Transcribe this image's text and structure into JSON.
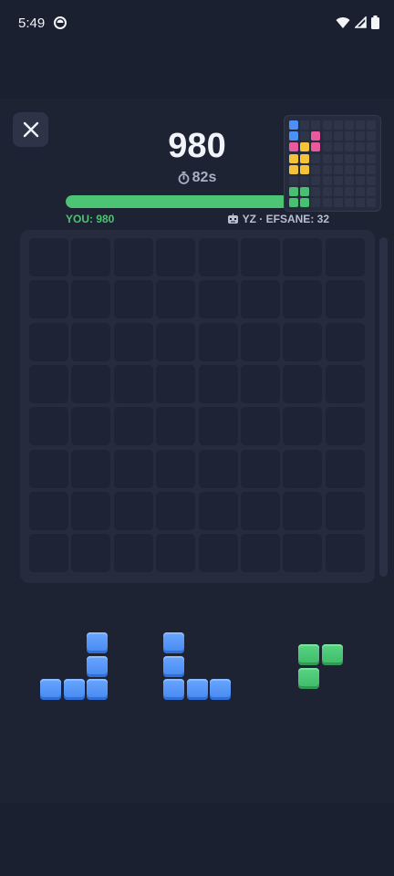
{
  "status": {
    "time": "5:49"
  },
  "game": {
    "score": "980",
    "timer": "82s",
    "you_label": "YOU: 980",
    "opponent_label": "YZ · EFSANE: 32",
    "progress_fraction": 0.84
  },
  "colors": {
    "blue": "#4d90f5",
    "green": "#47c06f",
    "pink": "#e85a9c",
    "yellow": "#f3c437",
    "progress": "#4cc473"
  },
  "mini_board": {
    "cells": [
      {
        "r": 0,
        "c": 0,
        "color": "blue"
      },
      {
        "r": 1,
        "c": 0,
        "color": "blue"
      },
      {
        "r": 1,
        "c": 2,
        "color": "pink"
      },
      {
        "r": 2,
        "c": 0,
        "color": "pink"
      },
      {
        "r": 2,
        "c": 1,
        "color": "yellow"
      },
      {
        "r": 2,
        "c": 2,
        "color": "pink"
      },
      {
        "r": 3,
        "c": 0,
        "color": "yellow"
      },
      {
        "r": 3,
        "c": 1,
        "color": "yellow"
      },
      {
        "r": 4,
        "c": 0,
        "color": "yellow"
      },
      {
        "r": 4,
        "c": 1,
        "color": "yellow"
      },
      {
        "r": 6,
        "c": 0,
        "color": "green"
      },
      {
        "r": 6,
        "c": 1,
        "color": "green"
      },
      {
        "r": 7,
        "c": 0,
        "color": "green"
      },
      {
        "r": 7,
        "c": 1,
        "color": "green"
      }
    ]
  },
  "board": {
    "rows": 8,
    "cols": 8
  },
  "tray": {
    "pieces": [
      {
        "name": "piece-j-blue",
        "color": "blue",
        "cells": [
          [
            0,
            2
          ],
          [
            1,
            2
          ],
          [
            2,
            0
          ],
          [
            2,
            1
          ],
          [
            2,
            2
          ]
        ]
      },
      {
        "name": "piece-l-blue",
        "color": "blue",
        "cells": [
          [
            0,
            0
          ],
          [
            1,
            0
          ],
          [
            2,
            0
          ],
          [
            2,
            1
          ],
          [
            2,
            2
          ]
        ]
      },
      {
        "name": "piece-corner-green",
        "color": "green",
        "cells": [
          [
            0,
            0
          ],
          [
            0,
            1
          ],
          [
            1,
            0
          ]
        ]
      }
    ]
  }
}
